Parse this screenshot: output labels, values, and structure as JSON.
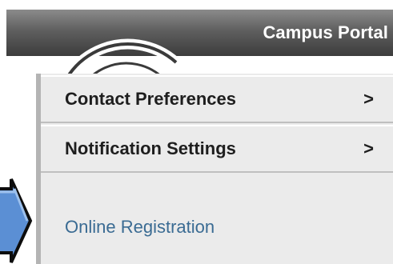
{
  "header": {
    "title": "Campus Portal"
  },
  "menu": {
    "items": [
      {
        "label": "Contact Preferences",
        "indicator": ">"
      },
      {
        "label": "Notification Settings",
        "indicator": ">"
      }
    ],
    "link": {
      "label": "Online Registration"
    }
  },
  "icons": {
    "logo": "logo-arcs-icon",
    "pointer": "arrow-pointer-icon",
    "submenu": "chevron-right-icon"
  },
  "colors": {
    "header_bar": "#5f5f5f",
    "menu_background": "#ebebeb",
    "link": "#3a6b93",
    "pointer_fill": "#5b8fd4"
  }
}
